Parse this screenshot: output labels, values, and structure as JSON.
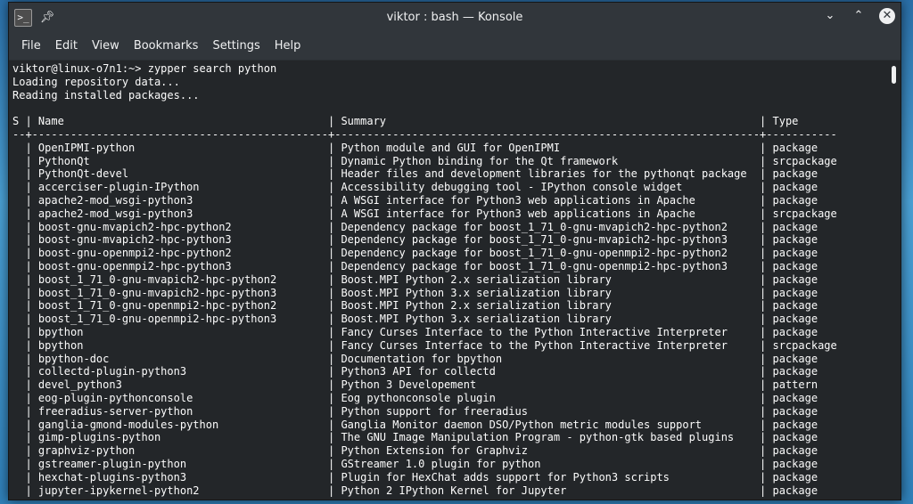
{
  "window": {
    "title": "viktor : bash — Konsole",
    "icons": {
      "app": "konsole-icon",
      "pin": "pin-icon",
      "minimize": "chevron-down-icon",
      "maximize": "chevron-up-icon",
      "close": "close-icon"
    }
  },
  "menubar": {
    "items": [
      "File",
      "Edit",
      "View",
      "Bookmarks",
      "Settings",
      "Help"
    ]
  },
  "terminal": {
    "lines": [
      "viktor@linux-o7n1:~> zypper search python",
      "Loading repository data...",
      "Reading installed packages...",
      "",
      "S | Name                                         | Summary                                                          | Type",
      "--+----------------------------------------------+------------------------------------------------------------------+-----------",
      "  | OpenIPMI-python                              | Python module and GUI for OpenIPMI                               | package",
      "  | PythonQt                                     | Dynamic Python binding for the Qt framework                      | srcpackage",
      "  | PythonQt-devel                               | Header files and development libraries for the pythonqt package  | package",
      "  | accerciser-plugin-IPython                    | Accessibility debugging tool - IPython console widget            | package",
      "  | apache2-mod_wsgi-python3                     | A WSGI interface for Python3 web applications in Apache          | package",
      "  | apache2-mod_wsgi-python3                     | A WSGI interface for Python3 web applications in Apache          | srcpackage",
      "  | boost-gnu-mvapich2-hpc-python2               | Dependency package for boost_1_71_0-gnu-mvapich2-hpc-python2     | package",
      "  | boost-gnu-mvapich2-hpc-python3               | Dependency package for boost_1_71_0-gnu-mvapich2-hpc-python3     | package",
      "  | boost-gnu-openmpi2-hpc-python2               | Dependency package for boost_1_71_0-gnu-openmpi2-hpc-python2     | package",
      "  | boost-gnu-openmpi2-hpc-python3               | Dependency package for boost_1_71_0-gnu-openmpi2-hpc-python3     | package",
      "  | boost_1_71_0-gnu-mvapich2-hpc-python2        | Boost.MPI Python 2.x serialization library                       | package",
      "  | boost_1_71_0-gnu-mvapich2-hpc-python3        | Boost.MPI Python 3.x serialization library                       | package",
      "  | boost_1_71_0-gnu-openmpi2-hpc-python2        | Boost.MPI Python 2.x serialization library                       | package",
      "  | boost_1_71_0-gnu-openmpi2-hpc-python3        | Boost.MPI Python 3.x serialization library                       | package",
      "  | bpython                                      | Fancy Curses Interface to the Python Interactive Interpreter     | package",
      "  | bpython                                      | Fancy Curses Interface to the Python Interactive Interpreter     | srcpackage",
      "  | bpython-doc                                  | Documentation for bpython                                        | package",
      "  | collectd-plugin-python3                      | Python3 API for collectd                                         | package",
      "  | devel_python3                                | Python 3 Developement                                            | pattern",
      "  | eog-plugin-pythonconsole                     | Eog pythonconsole plugin                                         | package",
      "  | freeradius-server-python                     | Python support for freeradius                                    | package",
      "  | ganglia-gmond-modules-python                 | Ganglia Monitor daemon DSO/Python metric modules support         | package",
      "  | gimp-plugins-python                          | The GNU Image Manipulation Program - python-gtk based plugins    | package",
      "  | graphviz-python                              | Python Extension for Graphviz                                    | package",
      "  | gstreamer-plugin-python                      | GStreamer 1.0 plugin for python                                  | package",
      "  | hexchat-plugins-python3                      | Plugin for HexChat adds support for Python3 scripts              | package",
      "  | jupyter-ipykernel-python2                    | Python 2 IPython Kernel for Jupyter                              | package"
    ]
  }
}
